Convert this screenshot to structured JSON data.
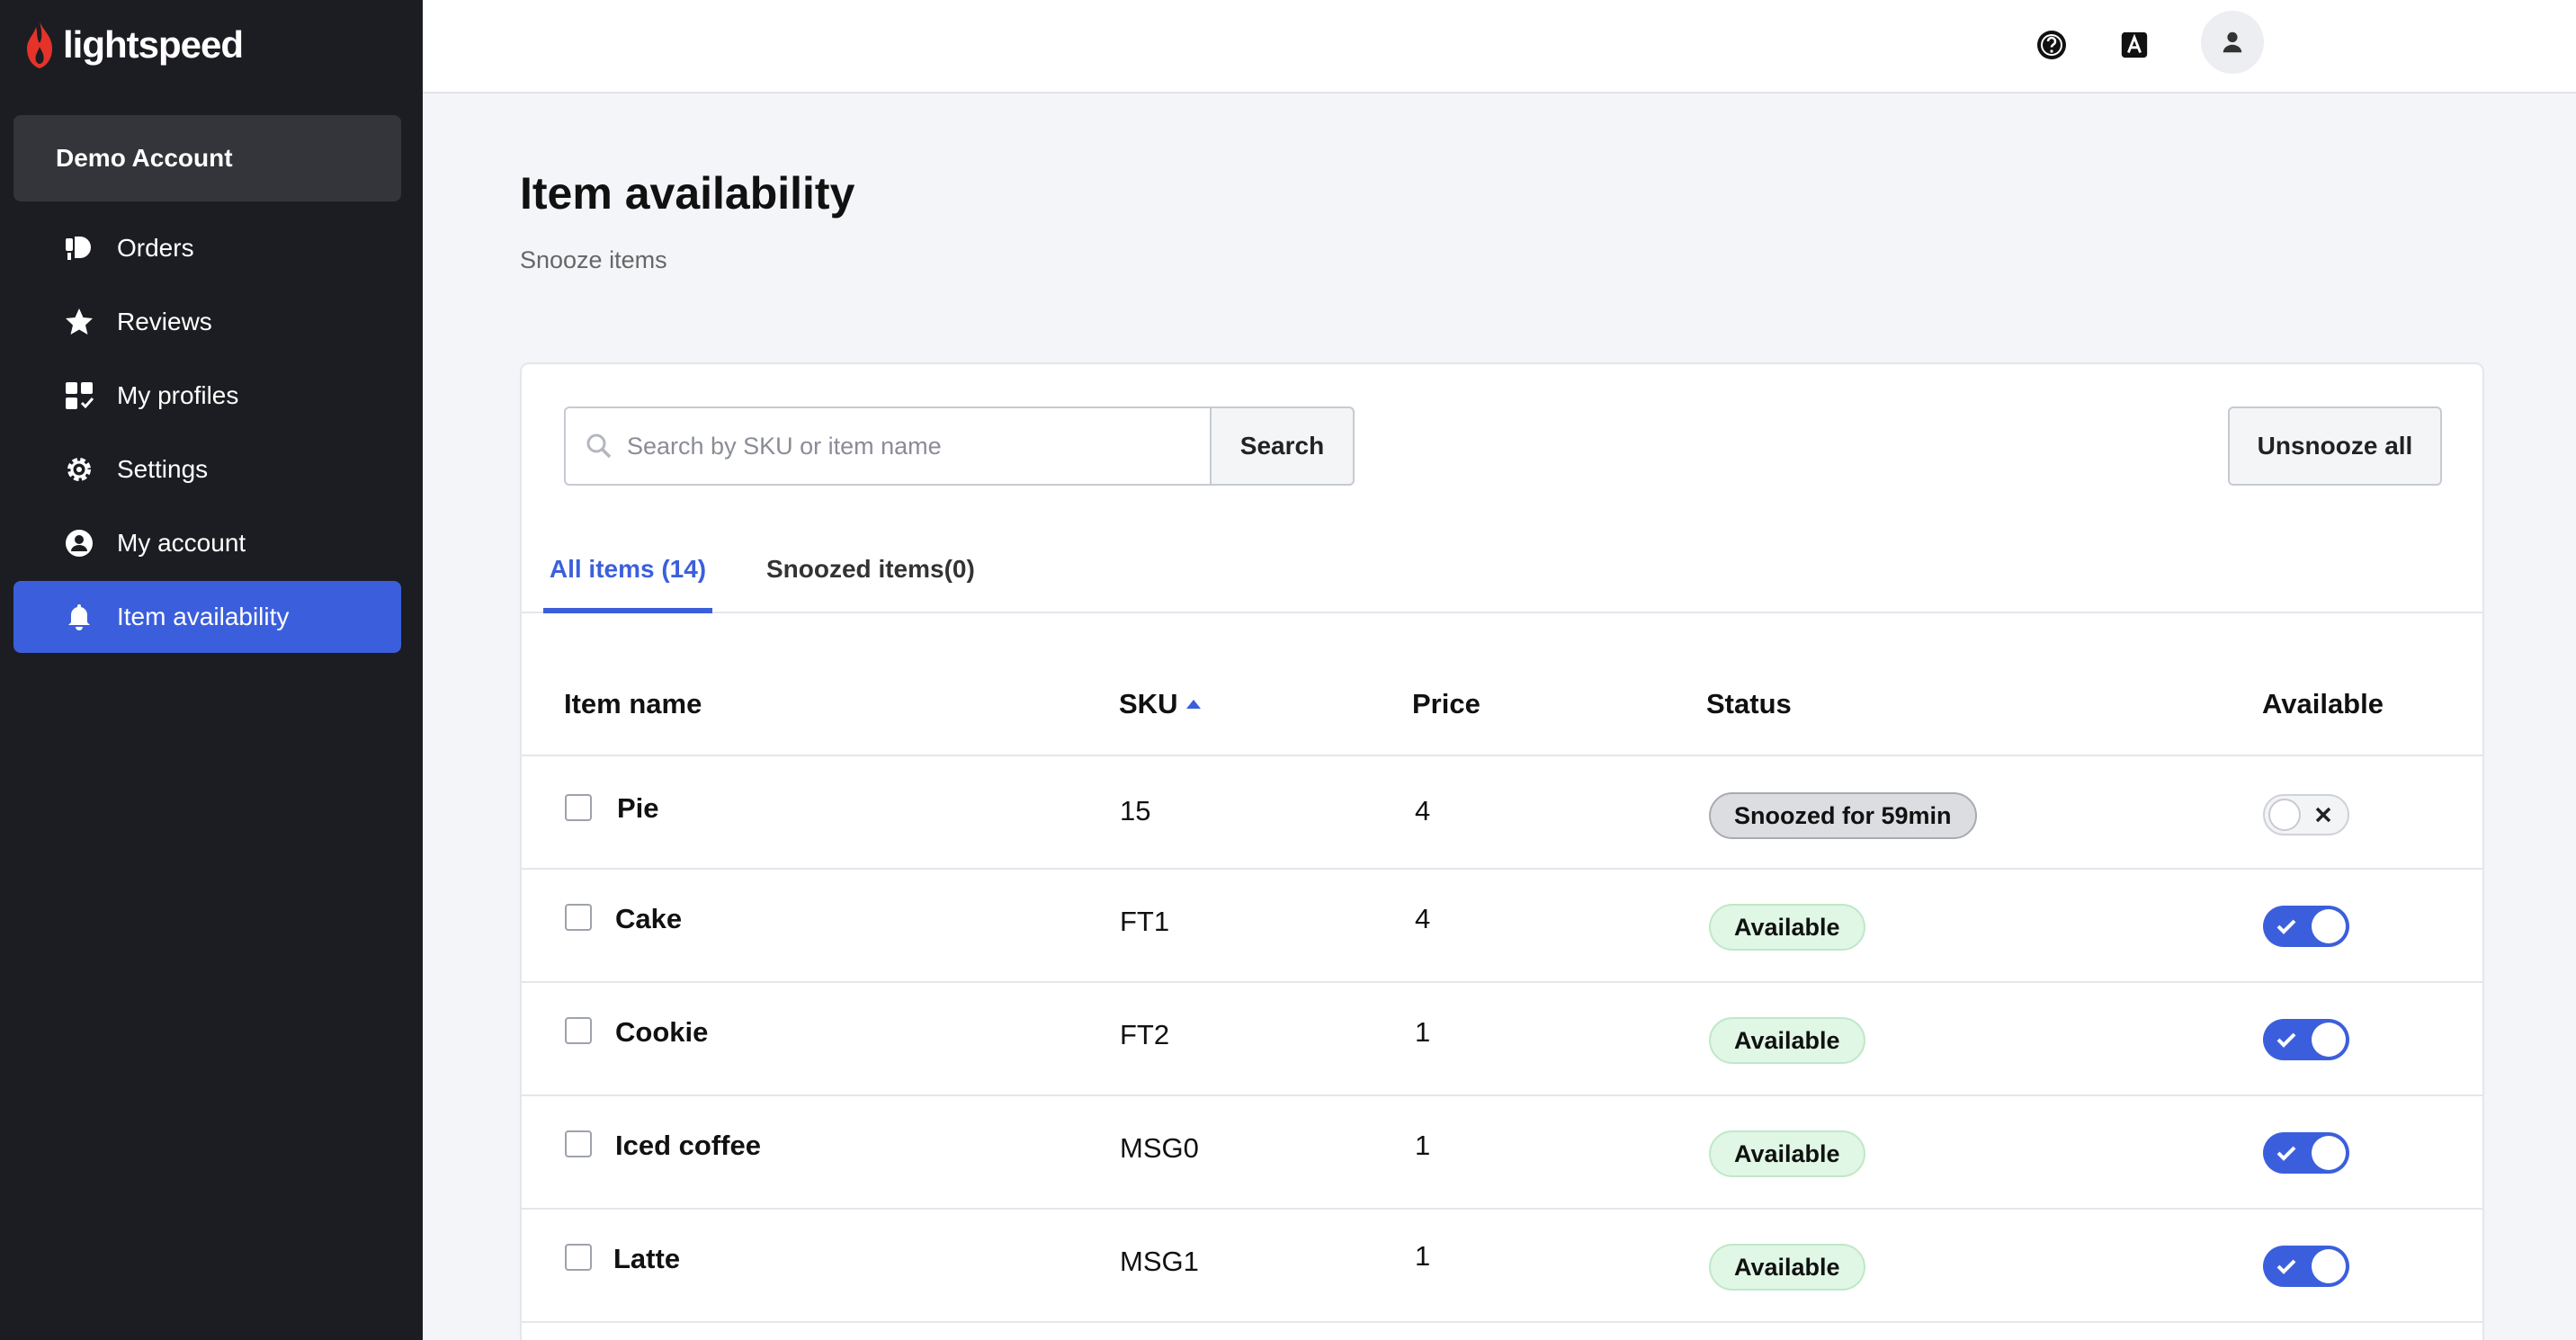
{
  "brand": {
    "name": "lightspeed",
    "accent": "#3b5fdc",
    "logo_color": "#e5332a"
  },
  "sidebar": {
    "account_name": "Demo Account",
    "items": [
      {
        "label": "Orders",
        "icon": "orders-icon"
      },
      {
        "label": "Reviews",
        "icon": "star-icon"
      },
      {
        "label": "My profiles",
        "icon": "profiles-icon"
      },
      {
        "label": "Settings",
        "icon": "gear-icon"
      },
      {
        "label": "My account",
        "icon": "user-circle-icon"
      },
      {
        "label": "Item availability",
        "icon": "bell-icon",
        "active": true
      }
    ]
  },
  "topbar": {
    "help_icon": "help-icon",
    "language_icon": "language-icon",
    "avatar_icon": "user-icon"
  },
  "page": {
    "title": "Item availability",
    "subtitle": "Snooze items"
  },
  "search": {
    "placeholder": "Search by SKU or item name",
    "value": "",
    "button_label": "Search"
  },
  "actions": {
    "unsnooze_all": "Unsnooze all"
  },
  "tabs": [
    {
      "label": "All items (14)",
      "active": true
    },
    {
      "label": "Snoozed items(0)",
      "active": false
    }
  ],
  "table": {
    "columns": [
      "Item name",
      "SKU",
      "Price",
      "Status",
      "Available"
    ],
    "sort": {
      "column": "SKU",
      "direction": "asc"
    },
    "rows": [
      {
        "name": "Pie",
        "sku": "15",
        "price": "4",
        "status": "Snoozed for 59min",
        "available": false
      },
      {
        "name": "Cake",
        "sku": "FT1",
        "price": "4",
        "status": "Available",
        "available": true
      },
      {
        "name": "Cookie",
        "sku": "FT2",
        "price": "1",
        "status": "Available",
        "available": true
      },
      {
        "name": "Iced coffee",
        "sku": "MSG0",
        "price": "1",
        "status": "Available",
        "available": true
      },
      {
        "name": "Latte",
        "sku": "MSG1",
        "price": "1",
        "status": "Available",
        "available": true
      }
    ]
  }
}
